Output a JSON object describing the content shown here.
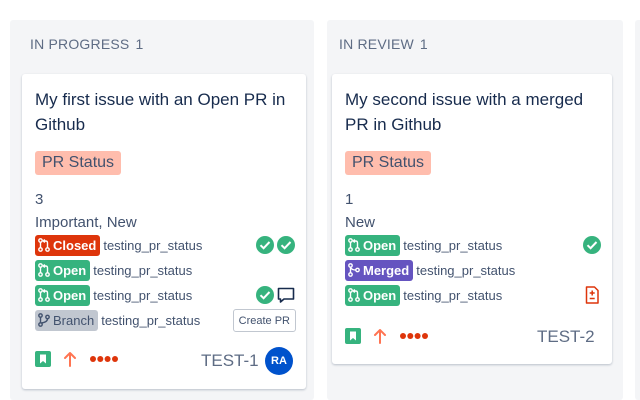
{
  "columns": [
    {
      "name": "IN PROGRESS",
      "count": "1",
      "card": {
        "title": "My first issue with an Open PR in Github",
        "status_badge": "PR Status",
        "number": "3",
        "labels": "Important, New",
        "prs": [
          {
            "state": "Closed",
            "repo": "testing_pr_status",
            "icons": [
              "check-circle",
              "check-circle"
            ]
          },
          {
            "state": "Open",
            "repo": "testing_pr_status",
            "icons": []
          },
          {
            "state": "Open",
            "repo": "testing_pr_status",
            "icons": [
              "check-circle",
              "comment"
            ]
          },
          {
            "state": "Branch",
            "repo": "testing_pr_status",
            "action": "Create PR"
          }
        ],
        "issue_key": "TEST-1",
        "avatar_initials": "RA",
        "footer_icons": [
          "story-icon",
          "priority-high-icon",
          "story-points-dots-icon"
        ]
      }
    },
    {
      "name": "IN REVIEW",
      "count": "1",
      "card": {
        "title": "My second issue with a merged PR in Github",
        "status_badge": "PR Status",
        "number": "1",
        "labels": "New",
        "prs": [
          {
            "state": "Open",
            "repo": "testing_pr_status",
            "icons": [
              "check-circle"
            ]
          },
          {
            "state": "Merged",
            "repo": "testing_pr_status",
            "icons": []
          },
          {
            "state": "Open",
            "repo": "testing_pr_status",
            "icons": [
              "file-diff"
            ]
          }
        ],
        "issue_key": "TEST-2",
        "footer_icons": [
          "story-icon",
          "priority-high-icon",
          "story-points-dots-icon"
        ]
      }
    }
  ],
  "colors": {
    "closed": "#de350b",
    "open": "#36b37e",
    "merged": "#6554c0",
    "branch": "#c1c7d0",
    "status_badge": "#ffbdad",
    "check": "#36b37e",
    "avatar": "#0052cc"
  }
}
